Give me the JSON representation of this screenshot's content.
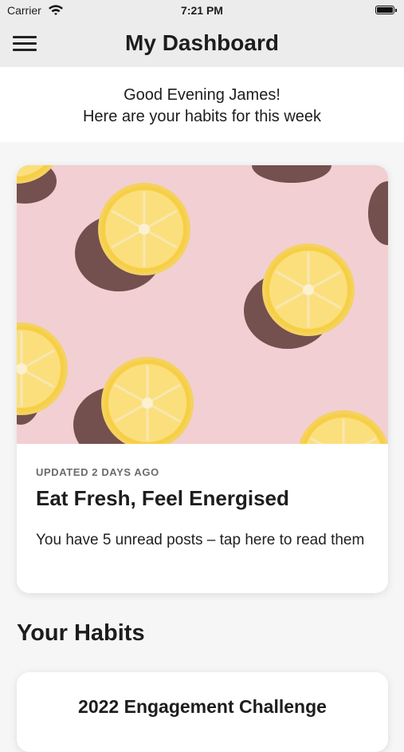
{
  "status_bar": {
    "carrier": "Carrier",
    "time": "7:21 PM",
    "icons": [
      "wifi-icon",
      "battery-icon"
    ]
  },
  "nav": {
    "title": "My Dashboard",
    "menu_icon": "hamburger-menu-icon"
  },
  "greeting": {
    "line1": "Good Evening James!",
    "line2": "Here are your habits for this week"
  },
  "featured_card": {
    "image": "lemon-halves-photo",
    "updated": "UPDATED 2 DAYS AGO",
    "title": "Eat Fresh, Feel Energised",
    "description": "You have 5 unread posts – tap here to read them"
  },
  "habits": {
    "section_title": "Your Habits",
    "items": [
      {
        "title": "2022 Engagement Challenge"
      }
    ]
  },
  "colors": {
    "header_background": "#ececec",
    "page_background": "#f6f6f6",
    "card_background": "#ffffff",
    "photo_background": "#f2cfd2",
    "lemon": "#f6cd3d"
  }
}
